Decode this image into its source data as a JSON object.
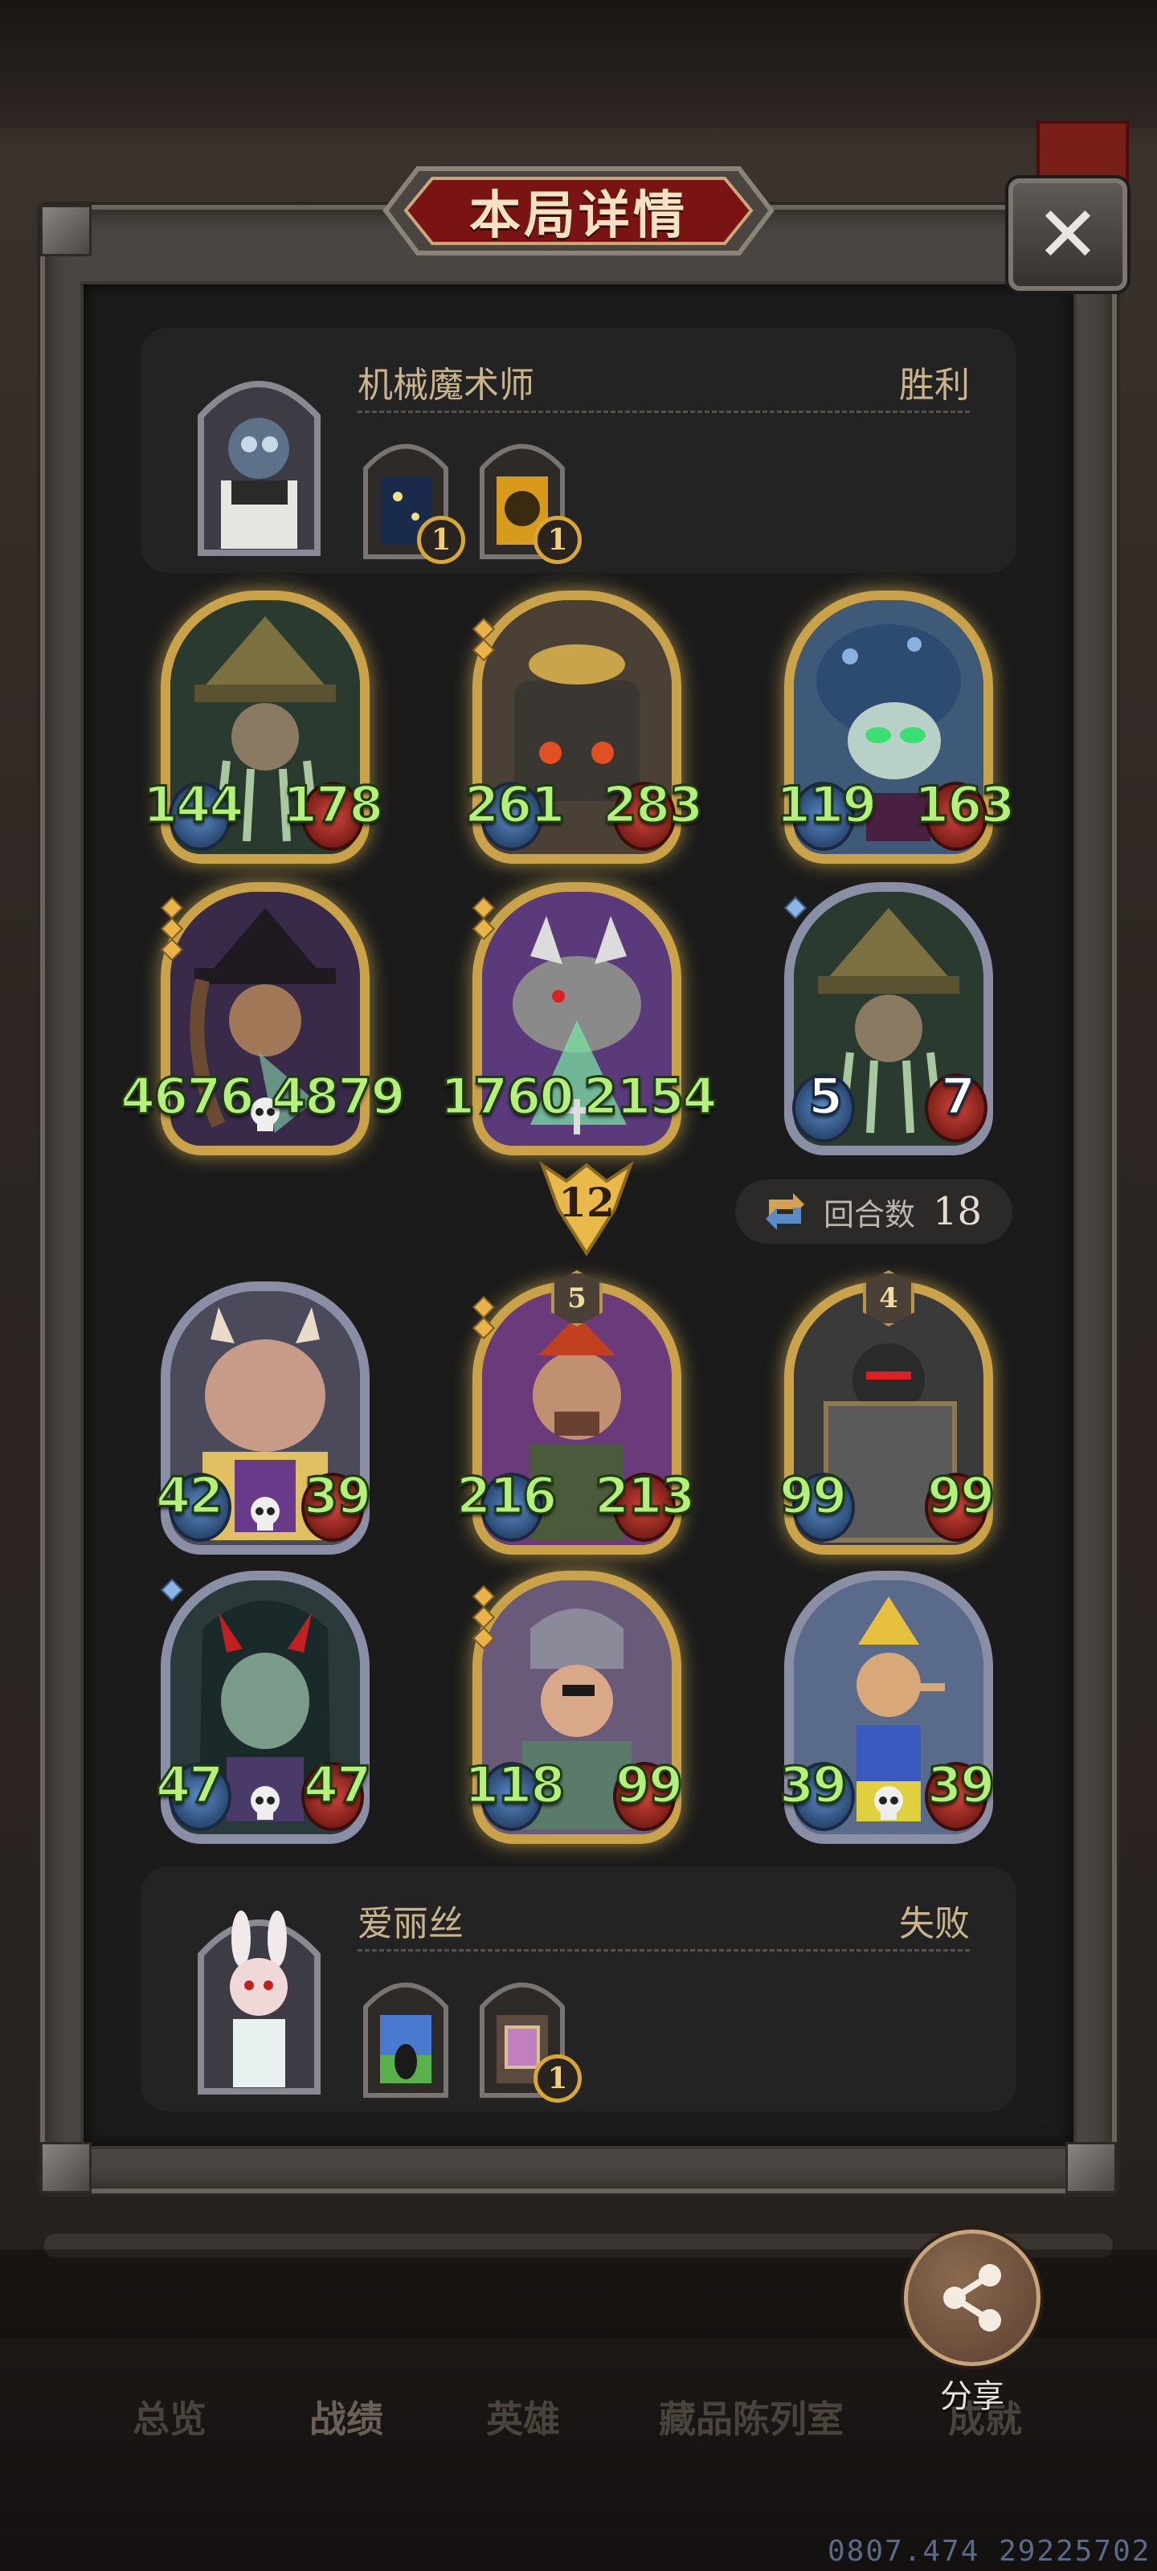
{
  "header": {
    "title": "本局详情",
    "close_icon": "close-icon"
  },
  "top_player": {
    "name": "机械魔术师",
    "result": "胜利",
    "relics": [
      {
        "count": "1"
      },
      {
        "count": "1"
      }
    ]
  },
  "top_units": [
    {
      "attack": "144",
      "health": "178"
    },
    {
      "attack": "261",
      "health": "283"
    },
    {
      "attack": "119",
      "health": "163"
    },
    {
      "attack": "4676",
      "health": "4879"
    },
    {
      "attack": "1760",
      "health": "2154"
    },
    {
      "attack": "5",
      "health": "7"
    }
  ],
  "battle_info": {
    "level": "12",
    "turn_label": "回合数",
    "turn_value": "18"
  },
  "bottom_units": [
    {
      "attack": "42",
      "health": "39"
    },
    {
      "attack": "216",
      "health": "213",
      "tier": "5"
    },
    {
      "attack": "99",
      "health": "99",
      "tier": "4"
    },
    {
      "attack": "47",
      "health": "47"
    },
    {
      "attack": "118",
      "health": "99"
    },
    {
      "attack": "39",
      "health": "39"
    }
  ],
  "bottom_player": {
    "name": "爱丽丝",
    "result": "失败",
    "relics": [
      {
        "count": ""
      },
      {
        "count": "1"
      }
    ]
  },
  "share": {
    "label": "分享"
  },
  "tabs": [
    "总览",
    "战绩",
    "英雄",
    "藏品陈列室",
    "成就"
  ],
  "watermark": "0807.474 29225702",
  "colors": {
    "stat_green": "#b4f07a",
    "gold_border": "#c9a24a",
    "silver_border": "#8b8fa6",
    "title_red": "#7a1414"
  }
}
